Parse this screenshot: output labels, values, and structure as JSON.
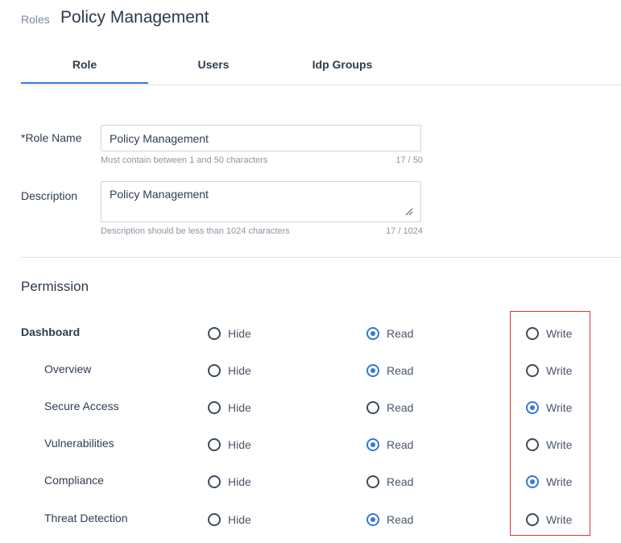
{
  "breadcrumb": "Roles",
  "title": "Policy Management",
  "tabs": [
    "Role",
    "Users",
    "Idp Groups"
  ],
  "form": {
    "role_name_label": "*Role Name",
    "role_name_value": "Policy Management",
    "role_name_help": "Must contain between 1 and 50 characters",
    "role_name_count": "17 / 50",
    "description_label": "Description",
    "description_value": "Policy Management",
    "description_help": "Description should be less than 1024 characters",
    "description_count": "17 / 1024"
  },
  "permission": {
    "title": "Permission",
    "options": [
      "Hide",
      "Read",
      "Write"
    ],
    "rows": [
      {
        "label": "Dashboard",
        "selected": "Read"
      },
      {
        "label": "Overview",
        "selected": "Read"
      },
      {
        "label": "Secure Access",
        "selected": "Write"
      },
      {
        "label": "Vulnerabilities",
        "selected": "Read"
      },
      {
        "label": "Compliance",
        "selected": "Write"
      },
      {
        "label": "Threat Detection",
        "selected": "Read"
      }
    ]
  },
  "colors": {
    "accent": "#3478d9",
    "highlight_border": "#d9343d"
  }
}
